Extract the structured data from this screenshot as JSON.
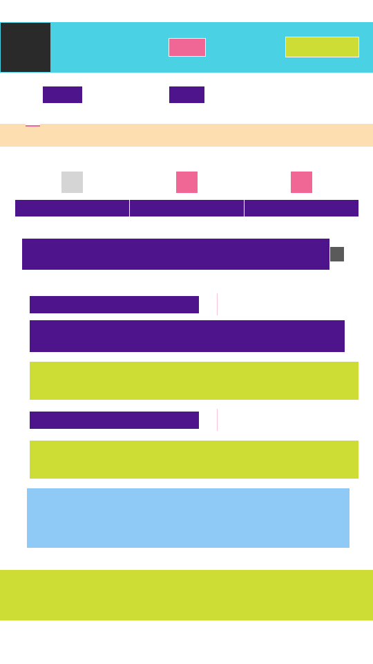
{
  "header": {
    "logo_label": "",
    "pink_button_label": "",
    "lime_button_label": ""
  },
  "top_buttons": {
    "button_a_label": "",
    "button_b_label": ""
  },
  "banner": {
    "text": ""
  },
  "steps": [
    {
      "label": ""
    },
    {
      "label": ""
    },
    {
      "label": ""
    }
  ],
  "tabs": [
    {
      "label": ""
    },
    {
      "label": ""
    },
    {
      "label": ""
    }
  ],
  "field_row": {
    "value": ""
  },
  "form": {
    "block1": {
      "label": "",
      "input_value": "",
      "panel_text": ""
    },
    "block2": {
      "label": "",
      "panel_text": ""
    }
  },
  "info_box": {
    "text": ""
  },
  "footer": {
    "text": ""
  },
  "colors": {
    "header_bg": "#4ad1e3",
    "dark": "#2a2a2a",
    "purple": "#4d148c",
    "pink": "#f06694",
    "lime": "#cddd35",
    "peach": "#fddeb0",
    "light_blue": "#8fcaf7",
    "grey": "#d5d5d5"
  }
}
